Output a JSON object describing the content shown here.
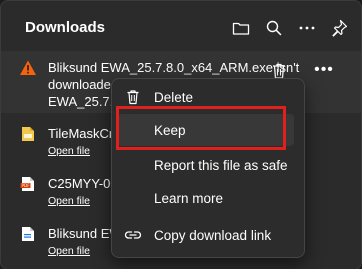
{
  "header": {
    "title": "Downloads",
    "icons": [
      "folder-icon",
      "search-icon",
      "more-options-icon",
      "pin-icon"
    ]
  },
  "downloads": [
    {
      "icon": "warning-icon",
      "line1": "Bliksund EWA_25.7.8.0_x64_ARM.exe isn't",
      "line2": "downloaded",
      "line3": "EWA_25.7.8."
    },
    {
      "icon": "file-icon",
      "name": "TileMaskCre",
      "action": "Open file"
    },
    {
      "icon": "pdf-icon",
      "name": "C25MYY-000",
      "action": "Open file"
    },
    {
      "icon": "file-icon",
      "name": "Bliksund EWA",
      "action": "Open file"
    }
  ],
  "context_menu": {
    "items": [
      {
        "icon": "delete-icon",
        "label": "Delete"
      },
      {
        "icon": "",
        "label": "Keep"
      },
      {
        "icon": "",
        "label": "Report this file as safe"
      },
      {
        "icon": "",
        "label": "Learn more"
      },
      {
        "icon": "link-icon",
        "label": "Copy download link"
      }
    ]
  },
  "colors": {
    "warning": "#f7630c",
    "highlight": "#e01f1f",
    "pdf": "#d83b01"
  }
}
